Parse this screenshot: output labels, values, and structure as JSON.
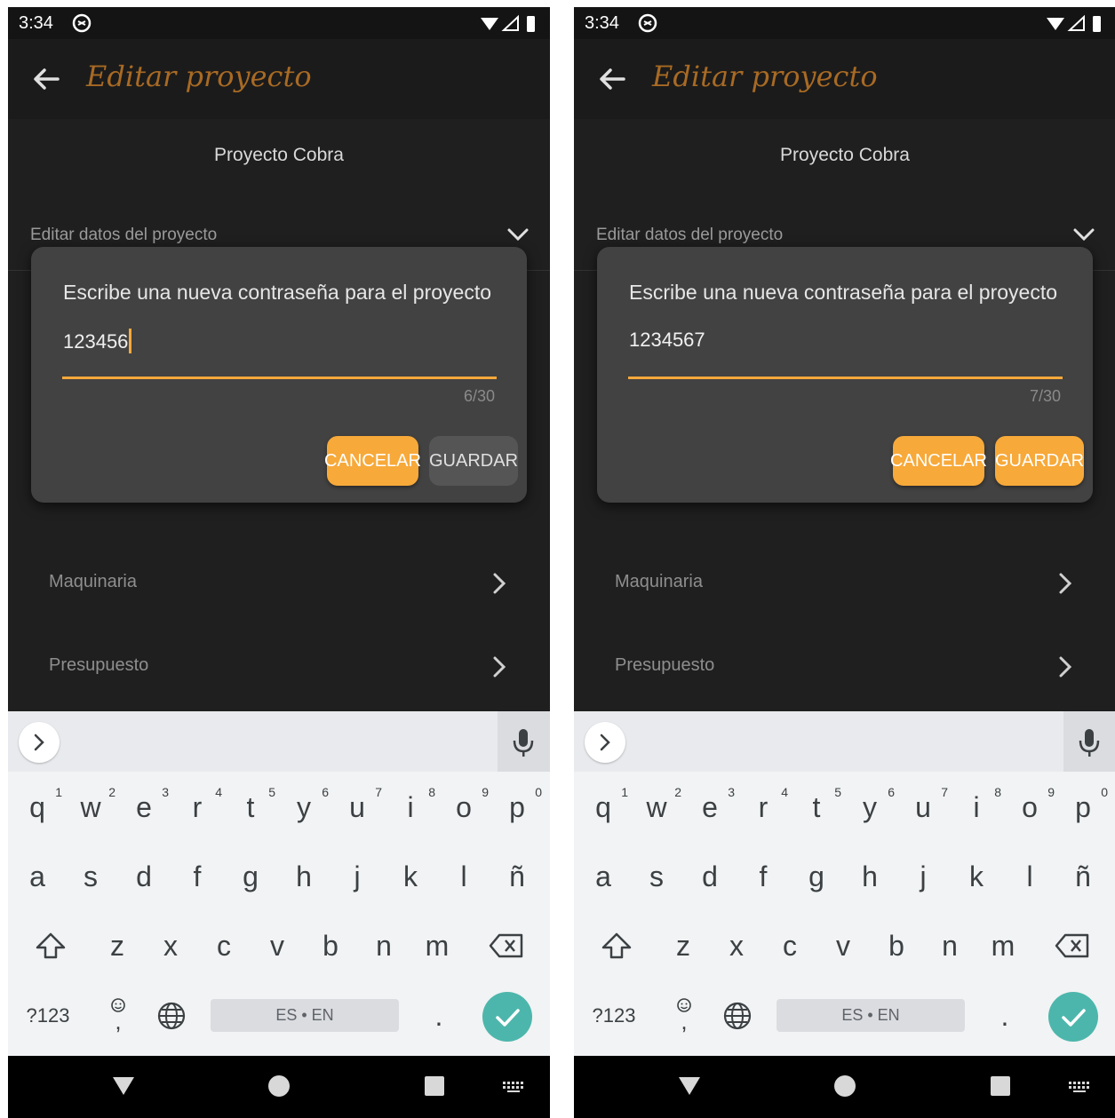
{
  "status_bar": {
    "time": "3:34"
  },
  "app_bar": {
    "title": "Editar proyecto"
  },
  "project": {
    "name": "Proyecto Cobra",
    "section_label": "Editar datos del proyecto"
  },
  "list_items": [
    {
      "label": "Maquinaria"
    },
    {
      "label": "Presupuesto"
    }
  ],
  "dialog": {
    "title": "Escribe una nueva contraseña para el proyecto",
    "cancel_label": "CANCELAR",
    "save_label": "GUARDAR"
  },
  "screens": [
    {
      "input_value": "123456",
      "counter": "6/30",
      "save_enabled": false
    },
    {
      "input_value": "1234567",
      "counter": "7/30",
      "save_enabled": true
    }
  ],
  "keyboard": {
    "row1": [
      "q",
      "w",
      "e",
      "r",
      "t",
      "y",
      "u",
      "i",
      "o",
      "p"
    ],
    "row1_hints": [
      "1",
      "2",
      "3",
      "4",
      "5",
      "6",
      "7",
      "8",
      "9",
      "0"
    ],
    "row2": [
      "a",
      "s",
      "d",
      "f",
      "g",
      "h",
      "j",
      "k",
      "l",
      "ñ"
    ],
    "row3": [
      "z",
      "x",
      "c",
      "v",
      "b",
      "n",
      "m"
    ],
    "symbols_label": "?123",
    "space_label": "ES • EN",
    "period_label": ".",
    "emoji_comma_label": ","
  },
  "colors": {
    "accent": "#f7a93a",
    "title_brown": "#a86a24",
    "dialog_bg": "#424242",
    "screen_bg": "#1f1f1f",
    "enter_key": "#4db6ac"
  }
}
